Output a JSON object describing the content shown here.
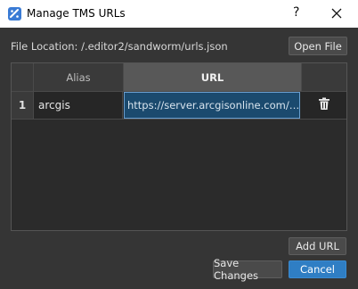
{
  "window": {
    "title": "Manage TMS URLs",
    "help_glyph": "?",
    "close_glyph": "✕"
  },
  "file_location": {
    "text": "File Location: /.editor2/sandworm/urls.json"
  },
  "buttons": {
    "open_file": "Open File",
    "add_url": "Add URL",
    "save_changes": "Save Changes",
    "cancel": "Cancel"
  },
  "table": {
    "columns": [
      "Alias",
      "URL",
      ""
    ],
    "rows": [
      {
        "num": "1",
        "alias": "arcgis",
        "url": "https://server.arcgisonline.com/…"
      }
    ]
  },
  "colors": {
    "accent": "#2f7ec4",
    "background": "#353535",
    "selected_cell": "#1b4a6e"
  },
  "icons": {
    "row_action": "trash-icon",
    "app": "map-icon"
  }
}
